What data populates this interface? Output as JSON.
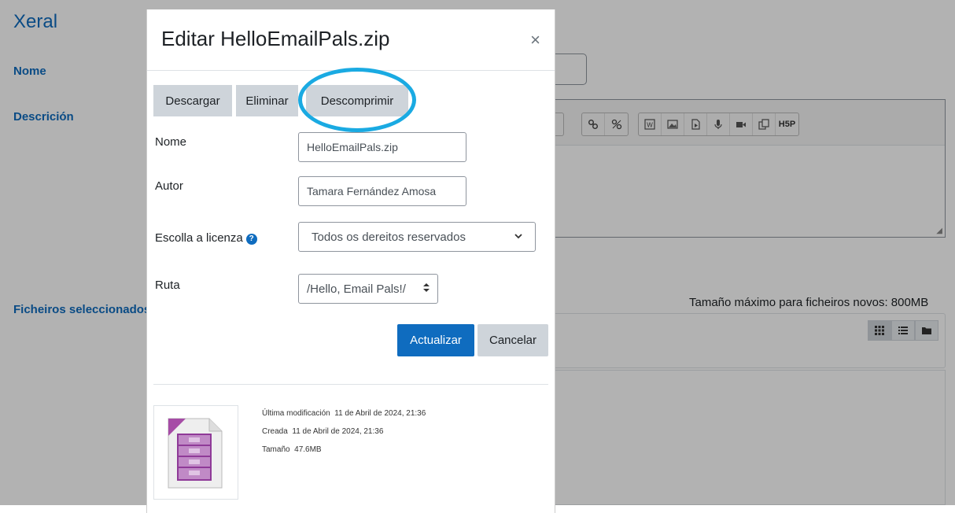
{
  "background": {
    "section_title": "Xeral",
    "labels": {
      "name": "Nome",
      "description": "Descrición",
      "files": "Ficheiros seleccionados"
    },
    "max_size": "Tamaño máximo para ficheiros novos: 800MB",
    "editor_toolbar_icons": [
      "link-icon",
      "unlink-icon",
      "word-icon",
      "image-icon",
      "media-icon",
      "microphone-icon",
      "video-icon",
      "copy-icon",
      "h5p-icon"
    ],
    "h5p_label": "H5P",
    "file_view_icons": [
      "grid-view-icon",
      "list-view-icon",
      "folder-view-icon"
    ]
  },
  "modal": {
    "title": "Editar HelloEmailPals.zip",
    "close_glyph": "×",
    "buttons": {
      "download": "Descargar",
      "delete": "Eliminar",
      "unzip": "Descomprimir"
    },
    "fields": {
      "name_label": "Nome",
      "name_value": "HelloEmailPals.zip",
      "author_label": "Autor",
      "author_value": "Tamara Fernández Amosa",
      "license_label": "Escolla a licenza",
      "license_value": "Todos os dereitos reservados",
      "path_label": "Ruta",
      "path_value": "/Hello, Email Pals!/"
    },
    "actions": {
      "update": "Actualizar",
      "cancel": "Cancelar"
    },
    "file_info": {
      "modified_label": "Última modificación",
      "modified_value": "11 de Abril de 2024, 21:36",
      "created_label": "Creada",
      "created_value": "11 de Abril de 2024, 21:36",
      "size_label": "Tamaño",
      "size_value": "47.6MB"
    }
  },
  "colors": {
    "accent": "#0f6cbf",
    "highlight": "#1aaae2",
    "secondary_button": "#ced4da",
    "archive_icon": "#a64ca6"
  }
}
